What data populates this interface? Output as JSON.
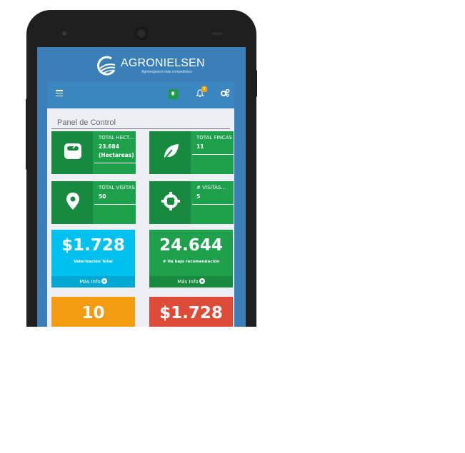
{
  "brand": {
    "name": "AGRONIELSEN",
    "tagline": "Agronegocios más competitivos"
  },
  "header": {
    "menu_icon": "hamburger-icon",
    "flag_icon": "flag-icon",
    "notifications_icon": "bell-icon",
    "notifications_count": "8",
    "settings_icon": "gears-icon"
  },
  "page": {
    "title": "Panel de Control"
  },
  "stat_boxes": [
    {
      "label": "TOTAL HECTAREAS",
      "value": "23.684",
      "unit": "(Hectareas)",
      "icon": "scale-icon"
    },
    {
      "label": "TOTAL FINCAS",
      "value": "11",
      "unit": "",
      "icon": "leaf-icon"
    },
    {
      "label": "TOTAL VISITAS",
      "value": "50",
      "unit": "",
      "icon": "map-marker-icon"
    },
    {
      "label": "# VISITAS...",
      "value": "5",
      "unit": "",
      "icon": "crosshairs-icon"
    }
  ],
  "big_boxes": [
    {
      "value": "$1.728",
      "label": "Valorización Total",
      "footer": "Más Info",
      "color": "#00c0ef",
      "footer_color": "#00a7d0"
    },
    {
      "value": "24.644",
      "label": "# Ha bajo recomendación",
      "footer": "Más Info",
      "color": "#1ea04c",
      "footer_color": "#178a3f"
    },
    {
      "value": "10",
      "color": "#f39c12"
    },
    {
      "value": "$1.728",
      "color": "#dd4b39"
    }
  ],
  "colors": {
    "screen_bg": "#3a7fb7",
    "navbar": "#3c86c0",
    "content_bg": "#ecf0f5",
    "green": "#1ea04c"
  }
}
